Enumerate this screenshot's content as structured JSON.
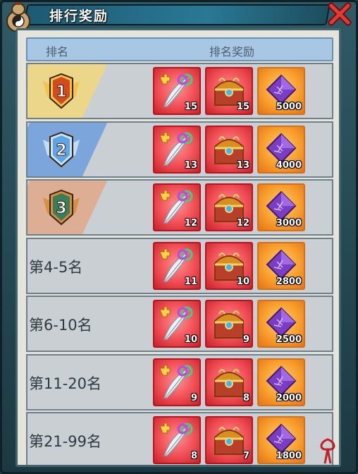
{
  "title": "排行奖励",
  "header": {
    "rank_label": "排名",
    "reward_label": "排名奖励"
  },
  "icons": {
    "close": "close-x-icon",
    "gourd": "gourd-icon",
    "knot": "knot-icon"
  },
  "colors": {
    "accent": "#2a7895",
    "item_red": "#f04d55",
    "item_orange": "#f79a29",
    "header_bg": "#a7c7e4"
  },
  "rows": [
    {
      "rank": "1",
      "rank_type": "badge",
      "badge_color": "gold",
      "items": [
        "15",
        "15",
        "5000"
      ]
    },
    {
      "rank": "2",
      "rank_type": "badge",
      "badge_color": "blue",
      "items": [
        "13",
        "13",
        "4000"
      ]
    },
    {
      "rank": "3",
      "rank_type": "badge",
      "badge_color": "bronze",
      "items": [
        "12",
        "12",
        "3000"
      ]
    },
    {
      "rank": "第4-5名",
      "rank_type": "text",
      "items": [
        "11",
        "10",
        "2800"
      ]
    },
    {
      "rank": "第6-10名",
      "rank_type": "text",
      "items": [
        "10",
        "9",
        "2500"
      ]
    },
    {
      "rank": "第11-20名",
      "rank_type": "text",
      "items": [
        "9",
        "8",
        "2000"
      ]
    },
    {
      "rank": "第21-99名",
      "rank_type": "text",
      "items": [
        "8",
        "7",
        "1800"
      ]
    }
  ]
}
